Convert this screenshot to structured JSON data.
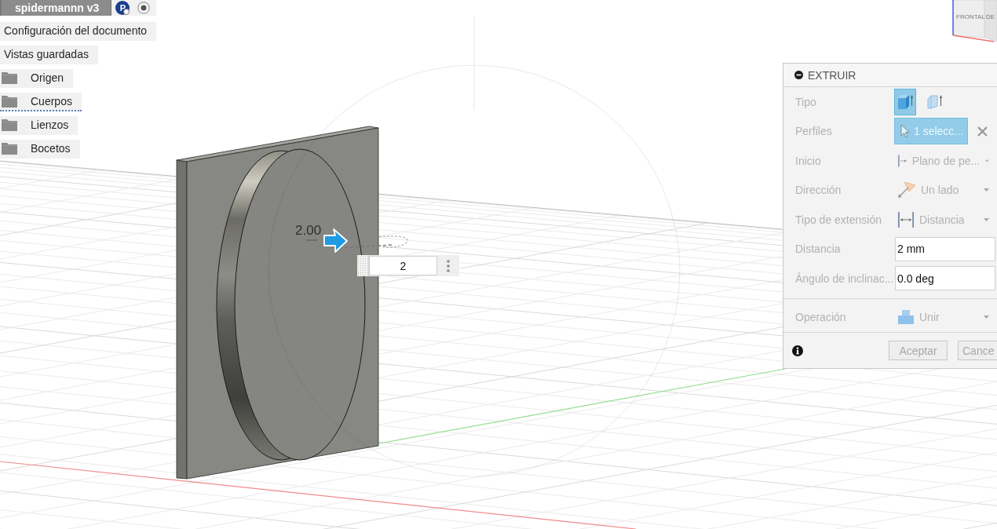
{
  "document": {
    "title": "spidermannn v3",
    "badge": "P"
  },
  "browser": {
    "items": [
      {
        "kind": "setting",
        "label": "Configuración del documento",
        "selected": false
      },
      {
        "kind": "setting",
        "label": "Vistas guardadas",
        "selected": false
      },
      {
        "kind": "folder",
        "label": "Origen",
        "selected": false
      },
      {
        "kind": "folder",
        "label": "Cuerpos",
        "selected": true
      },
      {
        "kind": "folder",
        "label": "Lienzos",
        "selected": false
      },
      {
        "kind": "folder",
        "label": "Bocetos",
        "selected": false
      }
    ]
  },
  "view_cube": {
    "faces": [
      "FRONTAL",
      "DE"
    ]
  },
  "viewport": {
    "dimension_label": "2.00",
    "distance_input": {
      "value": "2"
    }
  },
  "extrude_panel": {
    "title": "EXTRUIR",
    "disabled": true,
    "sections": [
      {
        "rows": [
          {
            "kind": "toggle",
            "label": "Tipo",
            "options": [
              {
                "selected": true
              },
              {
                "selected": false
              }
            ]
          },
          {
            "kind": "selection",
            "label": "Perfiles",
            "value": "1 selecc..."
          },
          {
            "kind": "dropdown",
            "label": "Inicio",
            "value": "Plano de pe..."
          },
          {
            "kind": "dropdown",
            "label": "Dirección",
            "value": "Un lado"
          },
          {
            "kind": "dropdown",
            "label": "Tipo de extensión",
            "value": "Distancia"
          },
          {
            "kind": "input",
            "label": "Distancia",
            "value": "2 mm"
          },
          {
            "kind": "input",
            "label": "Ángulo de inclinac...",
            "value": "0.0 deg"
          }
        ]
      },
      {
        "rows": [
          {
            "kind": "dropdown",
            "label": "Operación",
            "value": "Unir"
          }
        ]
      }
    ],
    "buttons": [
      "Aceptar",
      "Cance"
    ]
  }
}
